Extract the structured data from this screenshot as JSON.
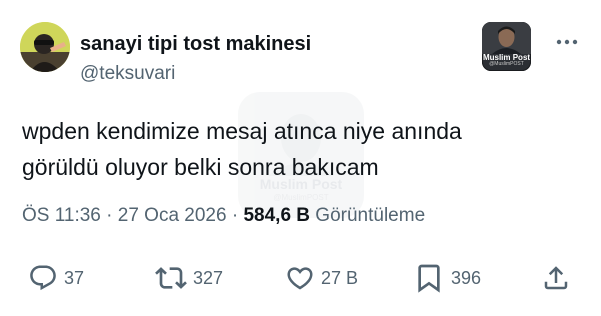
{
  "author": {
    "display_name": "sanayi tipi tost makinesi",
    "handle": "@teksuvari"
  },
  "badge": {
    "name": "Muslim Post",
    "subtext": "@MuslimPOST"
  },
  "watermark": {
    "name": "Muslim Post",
    "subtext": "@MuslimPOST"
  },
  "tweet": {
    "lines": [
      "wpden kendimize mesaj atınca niye anında",
      "görüldü oluyor belki sonra bakıcam"
    ],
    "time": "ÖS 11:36",
    "date": "27 Oca 2026",
    "separator": "·",
    "views": "584,6 B",
    "views_label": "Görüntüleme"
  },
  "actions": {
    "replies": "37",
    "retweets": "327",
    "likes": "27 B",
    "bookmarks": "396"
  },
  "icons": {
    "more": "more-horizontal-icon",
    "reply": "reply-icon",
    "retweet": "retweet-icon",
    "like": "heart-icon",
    "bookmark": "bookmark-icon",
    "share": "share-icon"
  },
  "colors": {
    "text": "#0f1419",
    "secondary": "#536471",
    "background": "#ffffff"
  }
}
